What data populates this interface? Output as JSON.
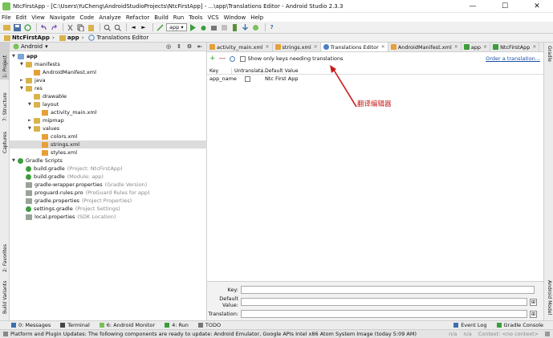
{
  "window": {
    "title": "NtcFirstApp - [C:\\Users\\YuCheng\\AndroidStudioProjects\\NtcFirstApp] - ...\\app\\Translations Editor - Android Studio 2.3.3",
    "minimize": "—",
    "maximize": "☐",
    "close": "✕"
  },
  "menu": [
    "File",
    "Edit",
    "View",
    "Navigate",
    "Code",
    "Analyze",
    "Refactor",
    "Build",
    "Run",
    "Tools",
    "VCS",
    "Window",
    "Help"
  ],
  "toolbar": {
    "run_config": "app"
  },
  "breadcrumb": [
    "NtcFirstApp",
    "app",
    "Translations Editor"
  ],
  "left_strip": {
    "project": "1: Project",
    "structure": "7: Structure",
    "captures": "Captures",
    "favorites": "2: Favorites",
    "build_variants": "Build Variants"
  },
  "right_strip": {
    "gradle": "Gradle",
    "android_model": "Android Model"
  },
  "project_panel": {
    "view": "Android",
    "tree": [
      {
        "label": "app",
        "bold": true,
        "kind": "fold",
        "indent": 0,
        "tri": "▼"
      },
      {
        "label": "manifests",
        "kind": "fold",
        "indent": 1,
        "tri": "▼"
      },
      {
        "label": "AndroidManifest.xml",
        "kind": "xml",
        "indent": 2,
        "tri": ""
      },
      {
        "label": "java",
        "kind": "fold",
        "indent": 1,
        "tri": "►"
      },
      {
        "label": "res",
        "kind": "fold",
        "indent": 1,
        "tri": "▼"
      },
      {
        "label": "drawable",
        "kind": "fold",
        "indent": 2,
        "tri": ""
      },
      {
        "label": "layout",
        "kind": "fold",
        "indent": 2,
        "tri": "▼"
      },
      {
        "label": "activity_main.xml",
        "kind": "xml",
        "indent": 3,
        "tri": ""
      },
      {
        "label": "mipmap",
        "kind": "fold",
        "indent": 2,
        "tri": "►"
      },
      {
        "label": "values",
        "kind": "fold",
        "indent": 2,
        "tri": "▼"
      },
      {
        "label": "colors.xml",
        "kind": "xml",
        "indent": 3,
        "tri": ""
      },
      {
        "label": "strings.xml",
        "kind": "xml",
        "indent": 3,
        "tri": "",
        "selected": true
      },
      {
        "label": "styles.xml",
        "kind": "xml",
        "indent": 3,
        "tri": ""
      },
      {
        "label": "Gradle Scripts",
        "kind": "grad",
        "indent": 0,
        "tri": "▼"
      },
      {
        "label": "build.gradle",
        "note": "(Project: NtcFirstApp)",
        "kind": "grad",
        "indent": 1,
        "tri": ""
      },
      {
        "label": "build.gradle",
        "note": "(Module: app)",
        "kind": "grad",
        "indent": 1,
        "tri": ""
      },
      {
        "label": "gradle-wrapper.properties",
        "note": "(Gradle Version)",
        "kind": "prop",
        "indent": 1,
        "tri": ""
      },
      {
        "label": "proguard-rules.pro",
        "note": "(ProGuard Rules for app)",
        "kind": "prop",
        "indent": 1,
        "tri": ""
      },
      {
        "label": "gradle.properties",
        "note": "(Project Properties)",
        "kind": "prop",
        "indent": 1,
        "tri": ""
      },
      {
        "label": "settings.gradle",
        "note": "(Project Settings)",
        "kind": "grad",
        "indent": 1,
        "tri": ""
      },
      {
        "label": "local.properties",
        "note": "(SDK Location)",
        "kind": "prop",
        "indent": 1,
        "tri": ""
      }
    ]
  },
  "editor_tabs": [
    {
      "label": "activity_main.xml",
      "color": "#e7a037"
    },
    {
      "label": "strings.xml",
      "color": "#e7a037"
    },
    {
      "label": "Translations Editor",
      "color": "#4a7fc1",
      "active": true
    },
    {
      "label": "AndroidManifest.xml",
      "color": "#e7a037"
    },
    {
      "label": "app",
      "color": "#3b9d3b"
    },
    {
      "label": "NtcFirstApp",
      "color": "#3b9d3b"
    }
  ],
  "translations": {
    "show_only_label": "Show only keys needing translations",
    "order_link": "Order a translation...",
    "columns": [
      "Key",
      "Untranslata...",
      "Default Value"
    ],
    "rows": [
      {
        "key": "app_name",
        "untranslatable": false,
        "default_value": "Ntc First App"
      }
    ],
    "annotation": "翻译编辑器",
    "key_label": "Key:",
    "default_value_label": "Default Value:",
    "translation_label": "Translation:"
  },
  "tool_windows": [
    "0: Messages",
    "Terminal",
    "6: Android Monitor",
    "4: Run",
    "TODO"
  ],
  "tool_windows_right": [
    "Event Log",
    "Gradle Console"
  ],
  "status": {
    "message": "Platform and Plugin Updates: The following components are ready to update: Android Emulator, Google APIs Intel x86 Atom System Image (today 5:09 AM)",
    "na1": "n/a",
    "na2": "n/a",
    "context": "Context: <no context>"
  }
}
